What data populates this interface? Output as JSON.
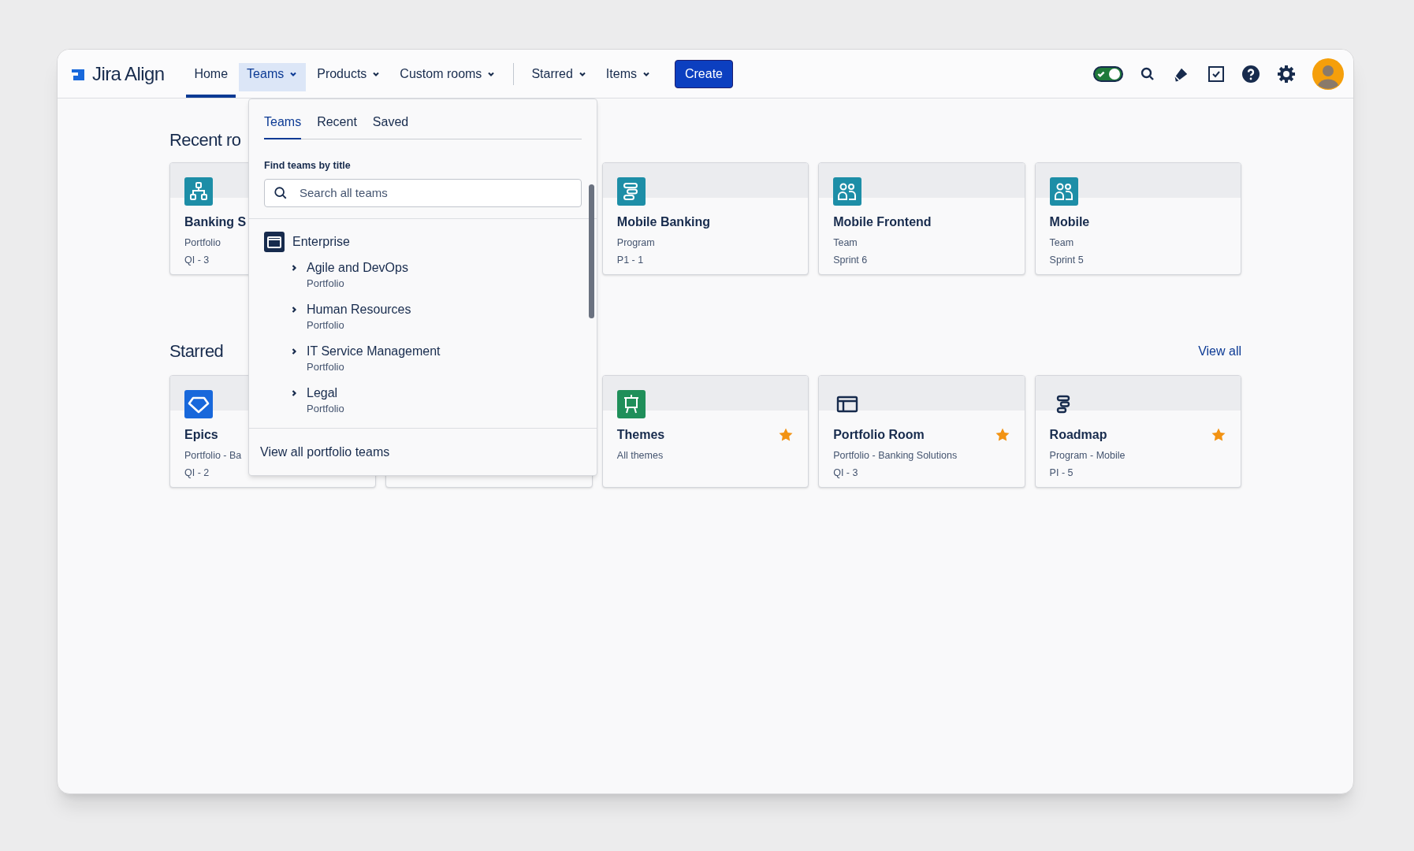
{
  "brand": {
    "name": "Jira Align"
  },
  "nav": [
    {
      "label": "Home",
      "selected": true,
      "open": false,
      "caret": false
    },
    {
      "label": "Teams",
      "selected": false,
      "open": true,
      "caret": true
    },
    {
      "label": "Products",
      "selected": false,
      "open": false,
      "caret": true
    },
    {
      "label": "Custom rooms",
      "selected": false,
      "open": false,
      "caret": true
    },
    {
      "label": "Starred",
      "selected": false,
      "open": false,
      "caret": true,
      "divider_before": true
    },
    {
      "label": "Items",
      "selected": false,
      "open": false,
      "caret": true
    }
  ],
  "create_button": "Create",
  "toggle": {
    "on": true
  },
  "recent": {
    "title": "Recent ro",
    "cards": [
      {
        "kind": "portfolio",
        "title": "Banking S",
        "subtitle": "Portfolio",
        "detail": "QI - 3",
        "starred": false
      },
      {
        "kind": "hidden"
      },
      {
        "kind": "program",
        "title": "Mobile Banking",
        "subtitle": "Program",
        "detail": "P1 - 1",
        "starred": false
      },
      {
        "kind": "team",
        "title": "Mobile Frontend",
        "subtitle": "Team",
        "detail": "Sprint 6",
        "starred": false
      },
      {
        "kind": "team",
        "title": "Mobile",
        "subtitle": "Team",
        "detail": "Sprint 5",
        "starred": false
      }
    ]
  },
  "starred": {
    "title": "Starred",
    "view_all": "View all",
    "cards": [
      {
        "kind": "epics",
        "title": "Epics",
        "subtitle": "Portfolio - Ba",
        "detail": "QI - 2",
        "starred": false
      },
      {
        "kind": "covered"
      },
      {
        "kind": "themes",
        "title": "Themes",
        "subtitle": "All themes",
        "starred": true
      },
      {
        "kind": "portfolio-room",
        "title": "Portfolio Room",
        "subtitle": "Portfolio - Banking Solutions",
        "detail": "QI - 3",
        "starred": true
      },
      {
        "kind": "roadmap",
        "title": "Roadmap",
        "subtitle": "Program - Mobile",
        "detail": "PI - 5",
        "starred": true
      }
    ]
  },
  "dropdown": {
    "tabs": [
      {
        "label": "Teams",
        "selected": true
      },
      {
        "label": "Recent",
        "selected": false
      },
      {
        "label": "Saved",
        "selected": false
      }
    ],
    "search_label": "Find teams by title",
    "search": {
      "placeholder": "Search all teams"
    },
    "group": {
      "title": "Enterprise",
      "children": [
        {
          "title": "Agile and DevOps",
          "subtitle": "Portfolio",
          "expanded": false
        },
        {
          "title": "Human Resources",
          "subtitle": "Portfolio",
          "expanded": false
        },
        {
          "title": "IT Service Management",
          "subtitle": "Portfolio",
          "expanded": false
        },
        {
          "title": "Legal",
          "subtitle": "Portfolio",
          "expanded": false
        }
      ]
    },
    "footer": "View all portfolio teams"
  }
}
